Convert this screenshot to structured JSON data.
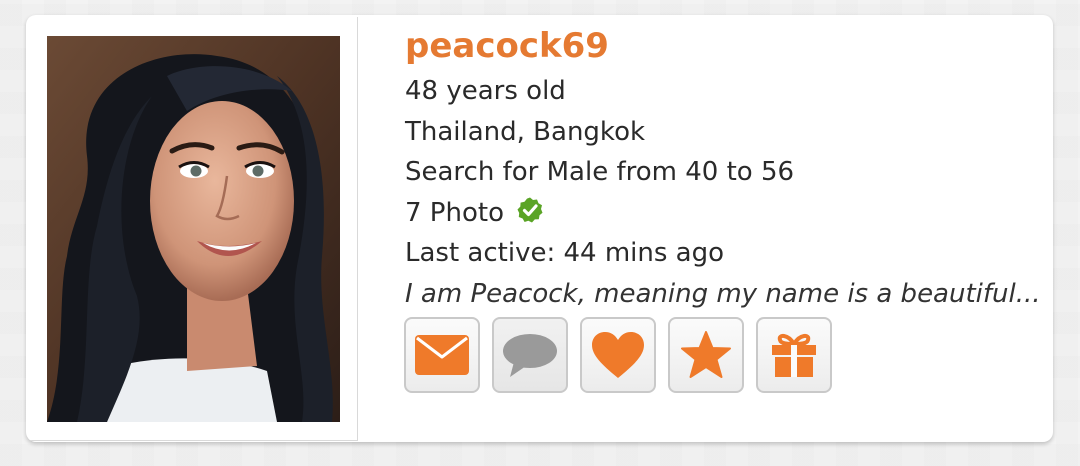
{
  "profile": {
    "username": "peacock69",
    "age": "48 years old",
    "location": "Thailand, Bangkok",
    "search": "Search for Male from 40 to 56",
    "photos": "7 Photo",
    "last_active": "Last active: 44 mins ago",
    "bio": "I am Peacock, meaning my name is a beautiful..."
  },
  "icons": {
    "verified": "check-circle-icon",
    "mail": "envelope-icon",
    "chat": "speech-bubble-icon",
    "like": "heart-icon",
    "favorite": "star-icon",
    "gift": "gift-icon"
  },
  "colors": {
    "accent": "#e57a32",
    "verified_green": "#5aa426",
    "chat_gray": "#9a9a9a"
  }
}
